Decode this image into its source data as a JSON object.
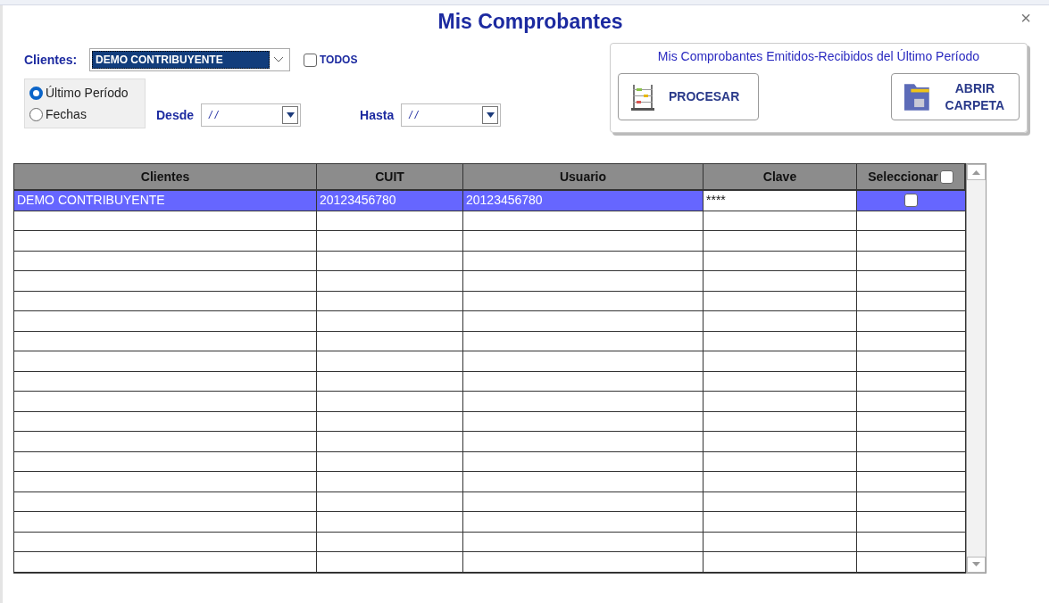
{
  "window": {
    "title": "Mis Comprobantes",
    "close": "×"
  },
  "filters": {
    "clientes_label": "Clientes:",
    "clientes_value": "DEMO CONTRIBUYENTE",
    "todos": {
      "label": "TODOS",
      "checked": false
    },
    "period_options": [
      {
        "label": "Último Período",
        "selected": true
      },
      {
        "label": "Fechas",
        "selected": false
      }
    ],
    "desde": {
      "label": "Desde",
      "value": "/ /"
    },
    "hasta": {
      "label": "Hasta",
      "value": "/ /"
    }
  },
  "panel": {
    "title": "Mis Comprobantes Emitidos-Recibidos del Último Período",
    "buttons": [
      {
        "kind": "abacus",
        "label": "PROCESAR"
      },
      {
        "kind": "folder",
        "label": "ABRIR CARPETA"
      }
    ]
  },
  "table": {
    "columns": [
      "Clientes",
      "CUIT",
      "Usuario",
      "Clave",
      "Seleccionar"
    ],
    "select_all_checked": false,
    "rows": [
      {
        "cells": [
          "DEMO CONTRIBUYENTE",
          "20123456780",
          "20123456780",
          "****"
        ],
        "selected": true,
        "checked": false
      }
    ]
  }
}
